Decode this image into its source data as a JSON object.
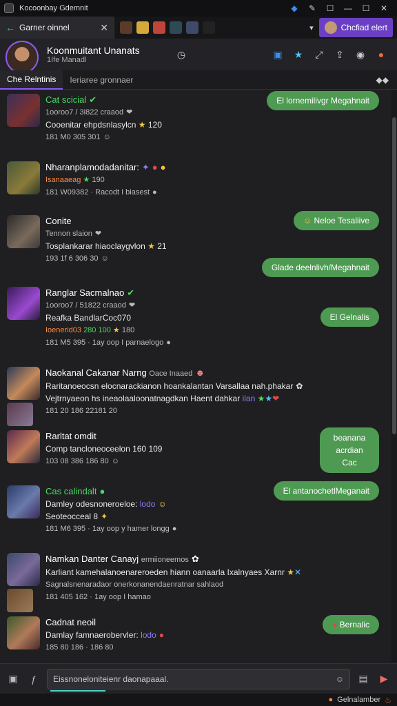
{
  "window": {
    "title": "Kocoonbay Gdemnit"
  },
  "tabs": {
    "active_label": "Garner oinnel",
    "purple_label": "Chcfiad elert"
  },
  "header": {
    "name": "Koonmuitant Unanats",
    "sub": "1Ife Manadl"
  },
  "subtabs": [
    "Che Relntinis",
    "Ieriaree gronnaer"
  ],
  "messages": [
    {
      "name": "Cat scicial",
      "l1": "1ooroo7 / 3i822 craaod",
      "l2": "Cooenitar ehpdsnlasylcn",
      "l2num": "120",
      "l3": "181 M0 305 301"
    },
    {
      "name": "Nharanplamodadanitar:",
      "l1": "Isanaaeag",
      "l1num": "190",
      "l2": "181 W09382 · Racodt I biasest"
    },
    {
      "name": "Conite",
      "l1": "Tennon slaion",
      "l2": "Tosplankarar hiaoclaygvlon",
      "l2num": "21",
      "l3": "193 1f 6 306 30"
    },
    {
      "name": "Ranglar Sacmalnao",
      "l1": "1ooroo7 / 51822 craaod",
      "l2": "Reafka BandlarCoc070",
      "l3": "Ioenerid03",
      "l3num": "280 100",
      "l3b": "180",
      "l4": "181 M5 395 · 1ay oop I parnaelogo"
    },
    {
      "name": "Naokanal Cakanar Narng",
      "nameSuffix": "Oace Inaaed",
      "l1": "Raritanoeocsn elocnarackianon hoankalantan Varsallaa nah.phakar",
      "l2": "Vejtrnyaeon hs ineaolaaloonatnagdkan Haent dahkar",
      "l2tag": "ilan",
      "l3": "181 20 186 22181 20"
    },
    {
      "name": "Rarltat omdit",
      "l1": "Comp tancloneoceelon 160",
      "l1num": "109",
      "l2": "103 08 386 186 80"
    },
    {
      "name": "Cas calindalt",
      "l1": "Damley odesnoneroeloe:",
      "l1tag": "lodo",
      "l2": "Seoteocceal 8",
      "l3": "181 M6 395 · 1ay oop y hamer longg"
    },
    {
      "name": "Namkan Danter Canayj",
      "nameSuffix": "ermiioneemos",
      "l1": "Karliant kamehalanoenareroeden hiann oanaarla Ixalnyaes Xarnr",
      "l2": "Sagnalsnenaradaor onerkonanendaenratnar sahlaod",
      "l3": "181 405 162 · 1ay oop I hamao"
    },
    {
      "name": "Cadnat neoil",
      "l1": "Damlay famnaerobervler:",
      "l1tag": "lodo",
      "l2": "185 80 186 · 186 80"
    }
  ],
  "bubbles": [
    "El lornemilivgr Megahnait",
    "Neloe Tesaliive",
    "Glade deelnlivh/Megahnait",
    "El Gelnalis",
    "beanana acrdian Cac",
    "El antanochetlMeganait",
    "Bernalic"
  ],
  "composer": {
    "placeholder": "Eissnoneloniteienr daonapaaal."
  },
  "statusbar": {
    "text": "Gelnalamber"
  }
}
